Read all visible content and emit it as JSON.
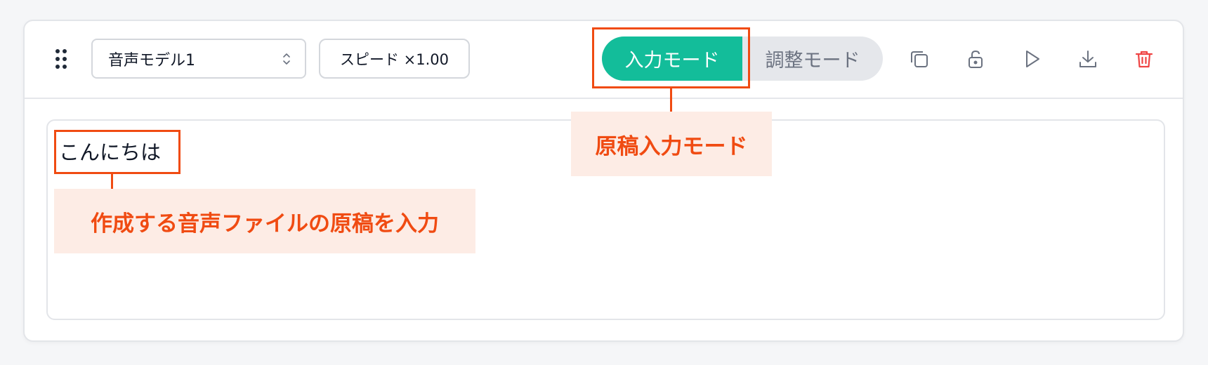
{
  "toolbar": {
    "model_select": {
      "value": "音声モデル1"
    },
    "speed_button": {
      "label": "スピード ×1.00"
    },
    "mode_toggle": {
      "input_label": "入力モード",
      "adjust_label": "調整モード",
      "active": "input"
    },
    "icons": [
      "copy-icon",
      "unlock-icon",
      "play-icon",
      "download-icon",
      "trash-icon"
    ]
  },
  "editor": {
    "text": "こんにちは"
  },
  "annotations": {
    "mode_callout": "原稿入力モード",
    "text_callout": "作成する音声ファイルの原稿を入力"
  },
  "colors": {
    "accent": "#13bd9a",
    "annotation": "#f04b12",
    "annotation_bg": "#fdece5",
    "delete": "#ef4444"
  }
}
